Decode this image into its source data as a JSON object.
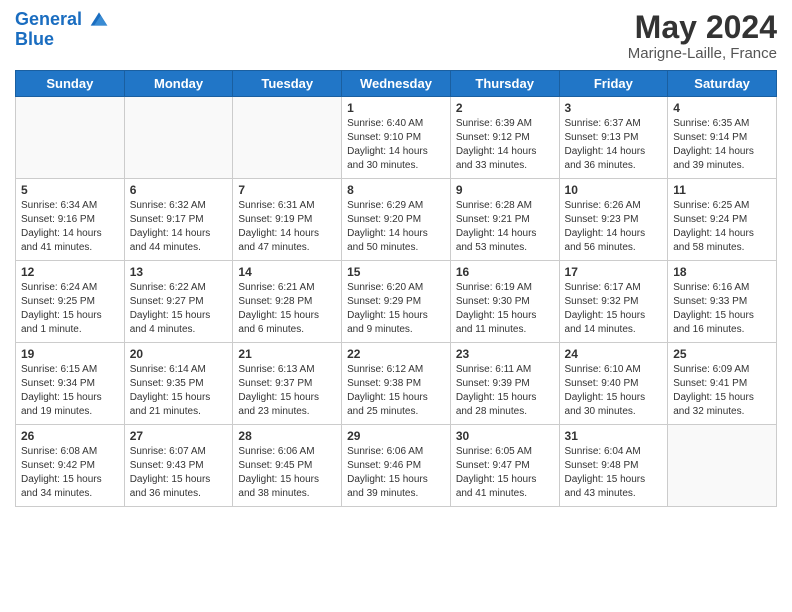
{
  "header": {
    "logo_line1": "General",
    "logo_line2": "Blue",
    "title": "May 2024",
    "subtitle": "Marigne-Laille, France"
  },
  "days_of_week": [
    "Sunday",
    "Monday",
    "Tuesday",
    "Wednesday",
    "Thursday",
    "Friday",
    "Saturday"
  ],
  "weeks": [
    [
      {
        "day": "",
        "info": ""
      },
      {
        "day": "",
        "info": ""
      },
      {
        "day": "",
        "info": ""
      },
      {
        "day": "1",
        "info": "Sunrise: 6:40 AM\nSunset: 9:10 PM\nDaylight: 14 hours\nand 30 minutes."
      },
      {
        "day": "2",
        "info": "Sunrise: 6:39 AM\nSunset: 9:12 PM\nDaylight: 14 hours\nand 33 minutes."
      },
      {
        "day": "3",
        "info": "Sunrise: 6:37 AM\nSunset: 9:13 PM\nDaylight: 14 hours\nand 36 minutes."
      },
      {
        "day": "4",
        "info": "Sunrise: 6:35 AM\nSunset: 9:14 PM\nDaylight: 14 hours\nand 39 minutes."
      }
    ],
    [
      {
        "day": "5",
        "info": "Sunrise: 6:34 AM\nSunset: 9:16 PM\nDaylight: 14 hours\nand 41 minutes."
      },
      {
        "day": "6",
        "info": "Sunrise: 6:32 AM\nSunset: 9:17 PM\nDaylight: 14 hours\nand 44 minutes."
      },
      {
        "day": "7",
        "info": "Sunrise: 6:31 AM\nSunset: 9:19 PM\nDaylight: 14 hours\nand 47 minutes."
      },
      {
        "day": "8",
        "info": "Sunrise: 6:29 AM\nSunset: 9:20 PM\nDaylight: 14 hours\nand 50 minutes."
      },
      {
        "day": "9",
        "info": "Sunrise: 6:28 AM\nSunset: 9:21 PM\nDaylight: 14 hours\nand 53 minutes."
      },
      {
        "day": "10",
        "info": "Sunrise: 6:26 AM\nSunset: 9:23 PM\nDaylight: 14 hours\nand 56 minutes."
      },
      {
        "day": "11",
        "info": "Sunrise: 6:25 AM\nSunset: 9:24 PM\nDaylight: 14 hours\nand 58 minutes."
      }
    ],
    [
      {
        "day": "12",
        "info": "Sunrise: 6:24 AM\nSunset: 9:25 PM\nDaylight: 15 hours\nand 1 minute."
      },
      {
        "day": "13",
        "info": "Sunrise: 6:22 AM\nSunset: 9:27 PM\nDaylight: 15 hours\nand 4 minutes."
      },
      {
        "day": "14",
        "info": "Sunrise: 6:21 AM\nSunset: 9:28 PM\nDaylight: 15 hours\nand 6 minutes."
      },
      {
        "day": "15",
        "info": "Sunrise: 6:20 AM\nSunset: 9:29 PM\nDaylight: 15 hours\nand 9 minutes."
      },
      {
        "day": "16",
        "info": "Sunrise: 6:19 AM\nSunset: 9:30 PM\nDaylight: 15 hours\nand 11 minutes."
      },
      {
        "day": "17",
        "info": "Sunrise: 6:17 AM\nSunset: 9:32 PM\nDaylight: 15 hours\nand 14 minutes."
      },
      {
        "day": "18",
        "info": "Sunrise: 6:16 AM\nSunset: 9:33 PM\nDaylight: 15 hours\nand 16 minutes."
      }
    ],
    [
      {
        "day": "19",
        "info": "Sunrise: 6:15 AM\nSunset: 9:34 PM\nDaylight: 15 hours\nand 19 minutes."
      },
      {
        "day": "20",
        "info": "Sunrise: 6:14 AM\nSunset: 9:35 PM\nDaylight: 15 hours\nand 21 minutes."
      },
      {
        "day": "21",
        "info": "Sunrise: 6:13 AM\nSunset: 9:37 PM\nDaylight: 15 hours\nand 23 minutes."
      },
      {
        "day": "22",
        "info": "Sunrise: 6:12 AM\nSunset: 9:38 PM\nDaylight: 15 hours\nand 25 minutes."
      },
      {
        "day": "23",
        "info": "Sunrise: 6:11 AM\nSunset: 9:39 PM\nDaylight: 15 hours\nand 28 minutes."
      },
      {
        "day": "24",
        "info": "Sunrise: 6:10 AM\nSunset: 9:40 PM\nDaylight: 15 hours\nand 30 minutes."
      },
      {
        "day": "25",
        "info": "Sunrise: 6:09 AM\nSunset: 9:41 PM\nDaylight: 15 hours\nand 32 minutes."
      }
    ],
    [
      {
        "day": "26",
        "info": "Sunrise: 6:08 AM\nSunset: 9:42 PM\nDaylight: 15 hours\nand 34 minutes."
      },
      {
        "day": "27",
        "info": "Sunrise: 6:07 AM\nSunset: 9:43 PM\nDaylight: 15 hours\nand 36 minutes."
      },
      {
        "day": "28",
        "info": "Sunrise: 6:06 AM\nSunset: 9:45 PM\nDaylight: 15 hours\nand 38 minutes."
      },
      {
        "day": "29",
        "info": "Sunrise: 6:06 AM\nSunset: 9:46 PM\nDaylight: 15 hours\nand 39 minutes."
      },
      {
        "day": "30",
        "info": "Sunrise: 6:05 AM\nSunset: 9:47 PM\nDaylight: 15 hours\nand 41 minutes."
      },
      {
        "day": "31",
        "info": "Sunrise: 6:04 AM\nSunset: 9:48 PM\nDaylight: 15 hours\nand 43 minutes."
      },
      {
        "day": "",
        "info": ""
      }
    ]
  ]
}
